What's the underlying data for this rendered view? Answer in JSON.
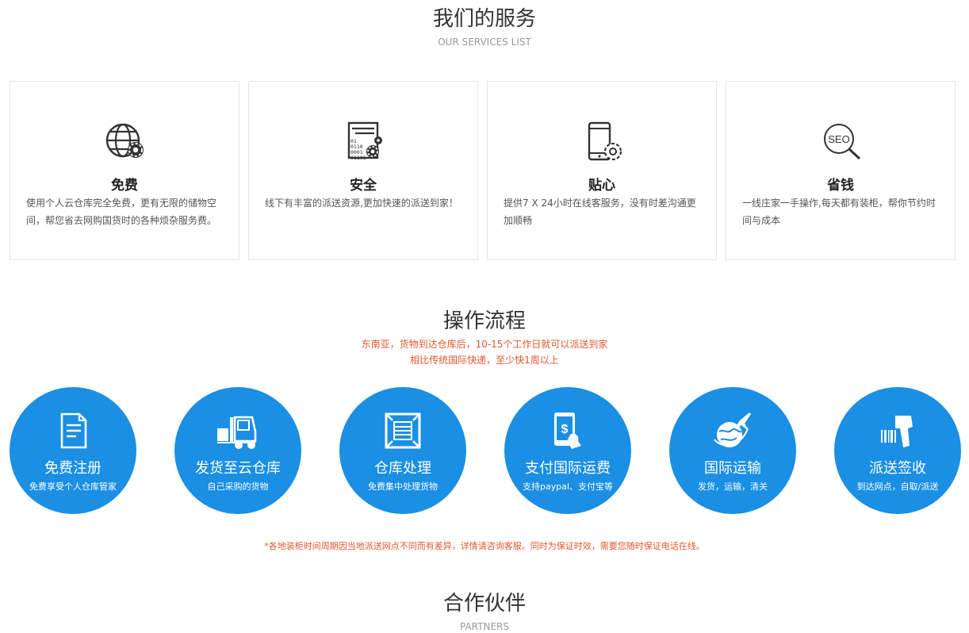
{
  "services": {
    "title": "我们的服务",
    "subtitle": "OUR SERVICES LIST",
    "cards": [
      {
        "title": "免费",
        "desc": "使用个人云仓库完全免费，更有无限的储物空间，帮您省去网购国货时的各种烦杂服务费。",
        "icon": "globe-gear-icon"
      },
      {
        "title": "安全",
        "desc": "线下有丰富的派送资源,更加快速的派送到家！",
        "icon": "document-binary-gear-icon"
      },
      {
        "title": "贴心",
        "desc": "提供7 X 24小时在线客服务，没有时差沟通更加顺畅",
        "icon": "phone-gear-icon"
      },
      {
        "title": "省钱",
        "desc": "一线庄家一手操作,每天都有装柜，帮你节约时间与成本",
        "icon": "seo-magnifier-icon",
        "icon_text": "SEO"
      }
    ]
  },
  "process": {
    "title": "操作流程",
    "line1": "东南亚，货物到达仓库后，10-15个工作日就可以派送到家",
    "line2": "相比传统国际快递，至少快1周以上",
    "steps": [
      {
        "title": "免费注册",
        "sub": "免费享受个人仓库管家",
        "icon": "document-icon"
      },
      {
        "title": "发货至云仓库",
        "sub": "自己采购的货物",
        "icon": "forklift-icon"
      },
      {
        "title": "仓库处理",
        "sub": "免费集中处理货物",
        "icon": "warehouse-icon"
      },
      {
        "title": "支付国际运费",
        "sub": "支持paypal、支付宝等",
        "icon": "mobile-payment-icon"
      },
      {
        "title": "国际运输",
        "sub": "发货，运输，清关",
        "icon": "globe-airplane-icon"
      },
      {
        "title": "派送签收",
        "sub": "到达网点，自取/派送",
        "icon": "barcode-scanner-icon"
      }
    ],
    "notice": "*各地装柜时间周期因当地派送网点不同而有差异，详情请咨询客服。同时为保证时效，需要您随时保证电话在线。"
  },
  "partners": {
    "title": "合作伙伴",
    "subtitle": "PARTNERS"
  },
  "colors": {
    "accent_blue": "#1a8fe3",
    "notice_red": "#e4572e"
  }
}
